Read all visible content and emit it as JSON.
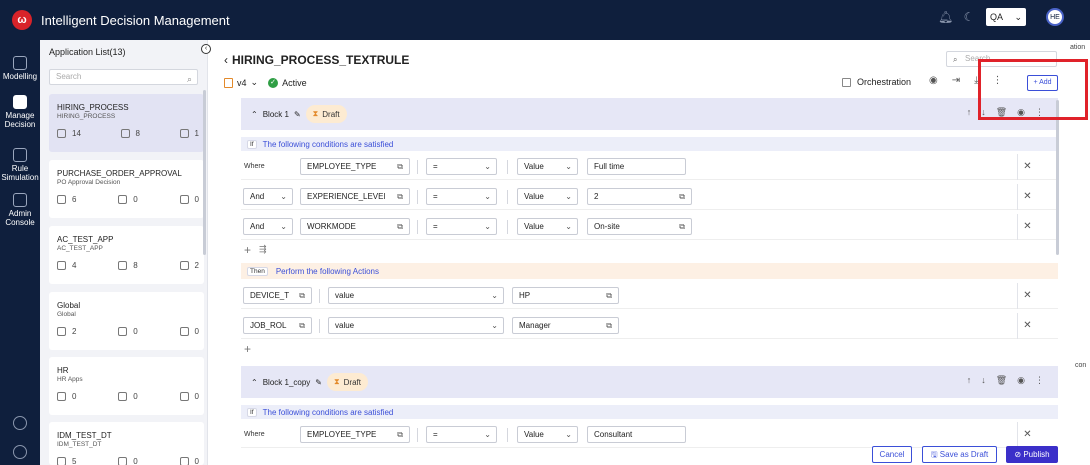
{
  "app": {
    "logo": "ω",
    "title": "Intelligent Decision Management",
    "environment": "QA",
    "avatar_initials": "HE"
  },
  "nav": {
    "items": [
      {
        "label": "Modelling",
        "icon": "cube-icon"
      },
      {
        "label": "Manage Decision",
        "icon": "decision-icon"
      },
      {
        "label": "Rule Simulation",
        "icon": "simulation-icon"
      },
      {
        "label": "Admin Console",
        "icon": "admin-icon"
      }
    ]
  },
  "app_list": {
    "header": "Application List(13)",
    "search_placeholder": "Search",
    "apps": [
      {
        "name": "HIRING_PROCESS",
        "sub": "HIRING_PROCESS",
        "rules": "14",
        "flows": "8",
        "models": "1"
      },
      {
        "name": "PURCHASE_ORDER_APPROVAL",
        "sub": "PO Approval Decision",
        "rules": "6",
        "flows": "0",
        "models": "0"
      },
      {
        "name": "AC_TEST_APP",
        "sub": "AC_TEST_APP",
        "rules": "4",
        "flows": "8",
        "models": "2"
      },
      {
        "name": "Global",
        "sub": "Global",
        "rules": "2",
        "flows": "0",
        "models": "0"
      },
      {
        "name": "HR",
        "sub": "HR Apps",
        "rules": "0",
        "flows": "0",
        "models": "0"
      },
      {
        "name": "IDM_TEST_DT",
        "sub": "IDM_TEST_DT",
        "rules": "5",
        "flows": "0",
        "models": "0"
      }
    ]
  },
  "rule": {
    "title": "HIRING_PROCESS_TEXTRULE",
    "version": "v4",
    "status": "Active",
    "search_placeholder": "Search",
    "orchestration_label": "Orchestration",
    "add_label": "+ Add"
  },
  "blocks": [
    {
      "name": "Block 1",
      "status": "Draft",
      "if_tag": "If",
      "conditions_label": "The following conditions are satisfied",
      "conditions": [
        {
          "connector": "Where",
          "field": "EMPLOYEE_TYPE",
          "operator": "=",
          "type": "Value",
          "value": "Full time"
        },
        {
          "connector": "And",
          "field": "EXPERIENCE_LEVEl",
          "operator": "=",
          "type": "Value",
          "value": "2"
        },
        {
          "connector": "And",
          "field": "WORKMODE",
          "operator": "=",
          "type": "Value",
          "value": "On-site"
        }
      ],
      "then_tag": "Then",
      "actions_label": "Perform the following Actions",
      "actions": [
        {
          "field": "DEVICE_T",
          "type": "value",
          "value": "HP"
        },
        {
          "field": "JOB_ROL",
          "type": "value",
          "value": "Manager"
        }
      ]
    },
    {
      "name": "Block 1_copy",
      "status": "Draft",
      "if_tag": "If",
      "conditions_label": "The following conditions are satisfied",
      "conditions": [
        {
          "connector": "Where",
          "field": "EMPLOYEE_TYPE",
          "operator": "=",
          "type": "Value",
          "value": "Consultant"
        }
      ]
    }
  ],
  "footer": {
    "cancel": "Cancel",
    "save_draft": "Save as Draft",
    "publish": "Publish"
  },
  "side_scraps": {
    "top": "ation",
    "mid": "con"
  }
}
